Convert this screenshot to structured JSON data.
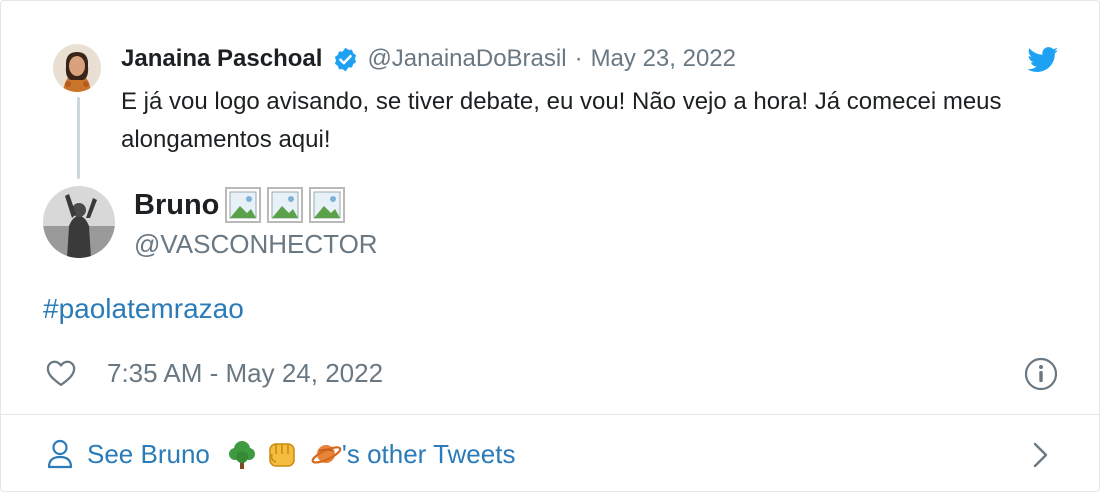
{
  "parent_tweet": {
    "name": "Janaina Paschoal",
    "handle": "@JanainaDoBrasil",
    "separator": "·",
    "date": "May 23, 2022",
    "text": "E já vou logo avisando, se tiver debate, eu vou! Não vejo a hora! Já comecei meus alongamentos aqui!"
  },
  "tweet": {
    "author_name": "Bruno",
    "author_handle": "@VASCONHECTOR",
    "hashtag": "#paolatemrazao",
    "timestamp": "7:35 AM - May 24, 2022"
  },
  "footer": {
    "prefix": "See Bruno",
    "suffix": "'s other Tweets"
  },
  "icons": {
    "brand": "twitter-bird-icon",
    "verified": "verified-badge-icon",
    "like": "heart-icon",
    "info": "info-icon",
    "profile": "person-icon",
    "chevron": "chevron-right-icon"
  },
  "colors": {
    "twitter_blue": "#1da1f2",
    "link_blue": "#2b7bb9",
    "text": "#1c2022",
    "muted": "#697882",
    "border": "#e1e8ed"
  }
}
